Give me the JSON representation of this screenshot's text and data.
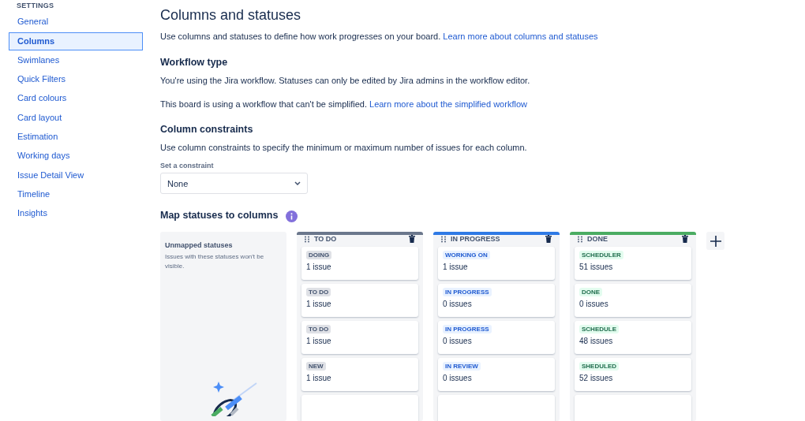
{
  "sidebar": {
    "heading": "SETTINGS",
    "items": [
      {
        "label": "General",
        "selected": false
      },
      {
        "label": "Columns",
        "selected": true
      },
      {
        "label": "Swimlanes",
        "selected": false
      },
      {
        "label": "Quick Filters",
        "selected": false
      },
      {
        "label": "Card colours",
        "selected": false
      },
      {
        "label": "Card layout",
        "selected": false
      },
      {
        "label": "Estimation",
        "selected": false
      },
      {
        "label": "Working days",
        "selected": false
      },
      {
        "label": "Issue Detail View",
        "selected": false
      },
      {
        "label": "Timeline",
        "selected": false
      },
      {
        "label": "Insights",
        "selected": false
      }
    ]
  },
  "page": {
    "title": "Columns and statuses",
    "intro": "Use columns and statuses to define how work progresses on your board.",
    "intro_link": "Learn more about columns and statuses"
  },
  "workflow": {
    "heading": "Workflow type",
    "text": "You're using the Jira workflow. Statuses can only be edited by Jira admins in the workflow editor.",
    "text2": "This board is using a workflow that can't be simplified.",
    "link": "Learn more about the simplified workflow"
  },
  "constraints": {
    "heading": "Column constraints",
    "text": "Use column constraints to specify the minimum or maximum number of issues for each column.",
    "label": "Set a constraint",
    "value": "None"
  },
  "mapping": {
    "heading": "Map statuses to columns",
    "unmapped": {
      "title": "Unmapped statuses",
      "text": "Issues with these statuses won't be visible."
    },
    "columns": [
      {
        "name": "TO DO",
        "kind": "todo",
        "color": "#6b778c",
        "statuses": [
          {
            "name": "DOING",
            "count": "1 issue"
          },
          {
            "name": "TO DO",
            "count": "1 issue"
          },
          {
            "name": "TO DO",
            "count": "1 issue"
          },
          {
            "name": "NEW",
            "count": "1 issue"
          }
        ]
      },
      {
        "name": "IN PROGRESS",
        "kind": "inprogress",
        "color": "#2f7ae5",
        "statuses": [
          {
            "name": "WORKING ON",
            "count": "1 issue"
          },
          {
            "name": "IN PROGRESS",
            "count": "0 issues"
          },
          {
            "name": "IN PROGRESS",
            "count": "0 issues"
          },
          {
            "name": "IN REVIEW",
            "count": "0 issues"
          }
        ]
      },
      {
        "name": "DONE",
        "kind": "done",
        "color": "#4bac62",
        "statuses": [
          {
            "name": "SCHEDULER",
            "count": "51 issues"
          },
          {
            "name": "DONE",
            "count": "0 issues"
          },
          {
            "name": "SCHEDULE",
            "count": "48 issues"
          },
          {
            "name": "SHEDULED",
            "count": "52 issues"
          }
        ]
      }
    ]
  }
}
